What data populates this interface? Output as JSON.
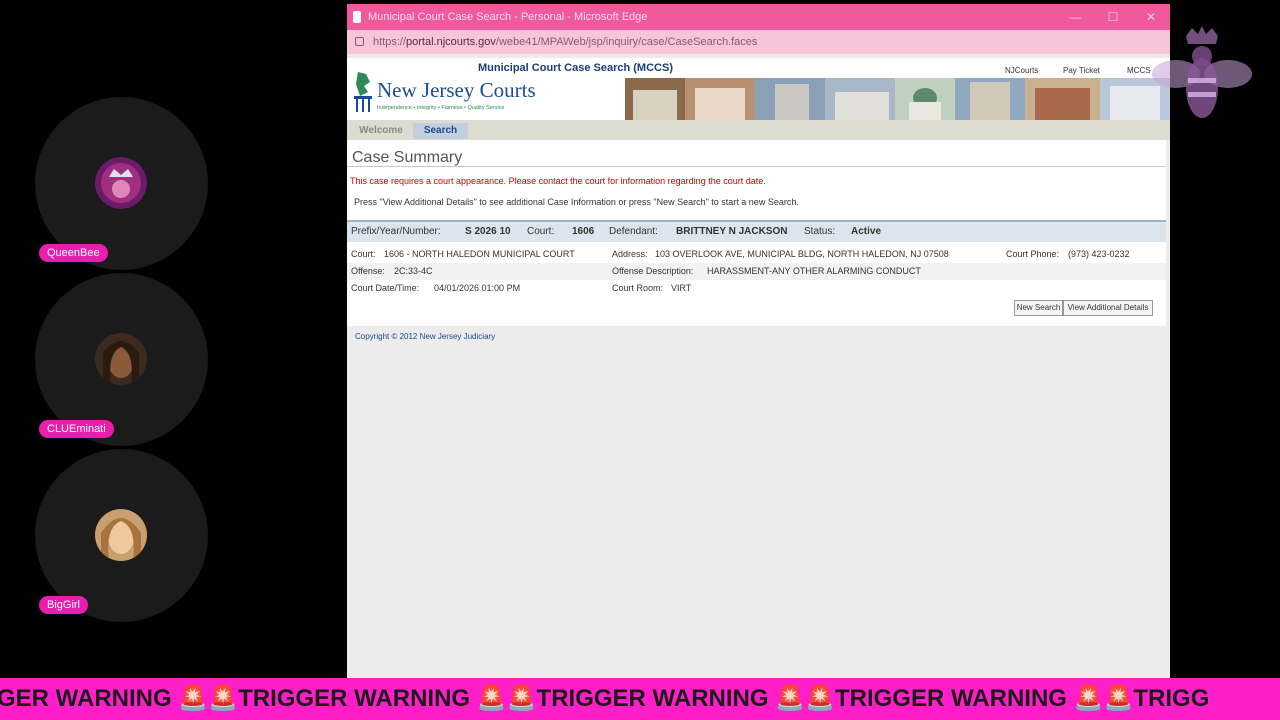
{
  "participants": [
    {
      "name": "QueenBee",
      "avatar_icon": "queen-crown-avatar"
    },
    {
      "name": "CLUEminati",
      "avatar_icon": "woman-portrait-avatar"
    },
    {
      "name": "BigGirl",
      "avatar_icon": "woman-portrait-avatar"
    }
  ],
  "browser": {
    "window_title": "Municipal Court Case Search - Personal - Microsoft Edge",
    "url_prefix": "https://",
    "url_domain": "portal.njcourts.gov",
    "url_path": "/webe41/MPAWeb/jsp/inquiry/case/CaseSearch.faces",
    "controls": {
      "minimize": "—",
      "maximize": "☐",
      "close": "✕"
    }
  },
  "site": {
    "logo_text": "New Jersey Courts",
    "logo_tagline": "Independence • Integrity • Fairness • Quality Service",
    "mccs_title": "Municipal Court Case Search (MCCS)",
    "top_links": [
      "NJCourts",
      "Pay Ticket",
      "MCCS"
    ]
  },
  "tabs": {
    "welcome": "Welcome",
    "search": "Search"
  },
  "case_summary": {
    "heading": "Case Summary",
    "notice": "This case requires a court appearance. Please contact the court for information regarding the court date.",
    "instructions": "Press \"View Additional Details\" to see additional Case Information or press \"New Search\" to start a new Search.",
    "bar": {
      "prefix_label": "Prefix/Year/Number:",
      "prefix_value": "S 2026 10",
      "court_label": "Court:",
      "court_value": "1606",
      "defendant_label": "Defendant:",
      "defendant_value": "BRITTNEY N JACKSON",
      "status_label": "Status:",
      "status_value": "Active"
    },
    "details": {
      "court_label": "Court:",
      "court_value": "1606 - NORTH HALEDON MUNICIPAL COURT",
      "address_label": "Address:",
      "address_value": "103 OVERLOOK AVE, MUNICIPAL BLDG, NORTH HALEDON, NJ 07508",
      "phone_label": "Court Phone:",
      "phone_value": "(973) 423-0232",
      "offense_label": "Offense:",
      "offense_value": "2C:33-4C",
      "offense_desc_label": "Offense Description:",
      "offense_desc_value": "HARASSMENT-ANY OTHER ALARMING CONDUCT",
      "datetime_label": "Court Date/Time:",
      "datetime_value": "04/01/2026 01:00 PM",
      "room_label": "Court Room:",
      "room_value": "VIRT"
    },
    "buttons": {
      "new_search": "New Search",
      "view_details": "View Additional Details"
    }
  },
  "footer": "Copyright © 2012 New Jersey Judiciary",
  "ticker": "GER WARNING 🚨🚨TRIGGER WARNING 🚨🚨TRIGGER WARNING 🚨🚨TRIGGER WARNING 🚨🚨TRIGG",
  "colors": {
    "ticker_bg": "#ff1ec8",
    "titlebar": "#f05a9c",
    "name_tag": "#e91eae"
  }
}
